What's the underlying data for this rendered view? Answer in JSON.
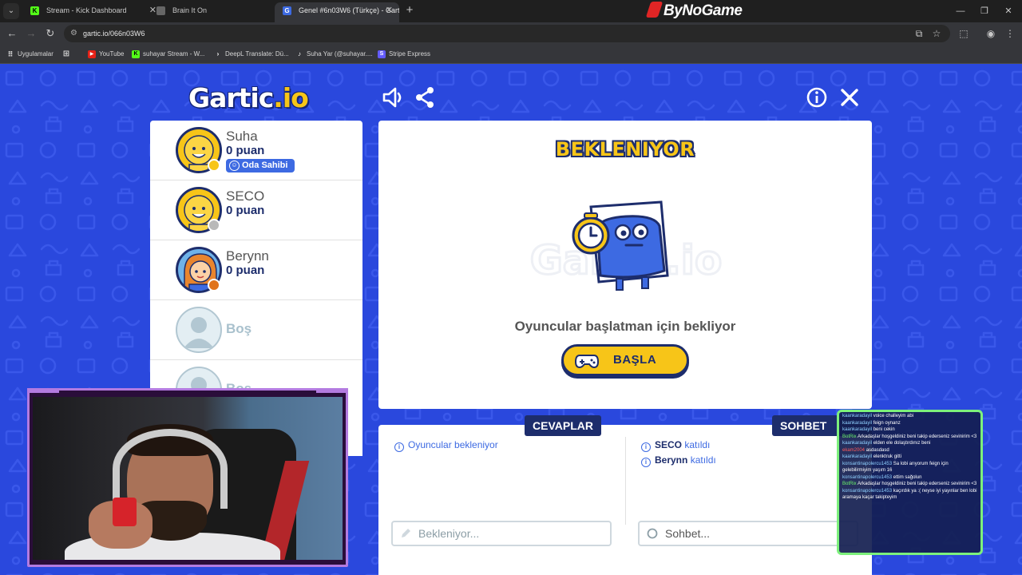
{
  "browser": {
    "tabs": [
      {
        "title": "Stream - Kick Dashboard",
        "favicon": "kick-icon",
        "color": "#53fc18"
      },
      {
        "title": "Brain It On",
        "favicon": "page-icon",
        "color": "#777777"
      },
      {
        "title": "Genel #6n03W6 (Türkçe) - Gart",
        "favicon": "gartic-icon",
        "color": "#3d6ae2"
      }
    ],
    "brand": "ByNoGame",
    "url": "gartic.io/066n03W6",
    "bookmarks": [
      {
        "label": "Uygulamalar"
      },
      {
        "label": "YouTube"
      },
      {
        "label": "suhayar Stream - W..."
      },
      {
        "label": "DeepL Translate: Dü..."
      },
      {
        "label": "Suha Yar (@suhayar...."
      },
      {
        "label": "Stripe Express"
      }
    ]
  },
  "game": {
    "logo_main": "Gartic",
    "logo_suffix": ".io",
    "players": [
      {
        "name": "Suha",
        "score": "0 puan",
        "badge": "Oda Sahibi",
        "status_color": "#f7c518",
        "avatar": "smiley-avatar"
      },
      {
        "name": "SECO",
        "score": "0 puan",
        "status_color": "#b9b9b9",
        "avatar": "smiley-avatar"
      },
      {
        "name": "Berynn",
        "score": "0 puan",
        "status_color": "#e0731c",
        "avatar": "girl-avatar"
      },
      {
        "name": "Boş",
        "empty": true
      },
      {
        "name": "Boş",
        "empty": true
      }
    ],
    "status_title": "BEKLENIYOR",
    "waiting_text": "Oyuncular başlatman için bekliyor",
    "start_button": "BAŞLA",
    "answers_label": "CEVAPLAR",
    "chat_label": "SOHBET",
    "answers_messages": [
      "Oyuncular bekleniyor"
    ],
    "chat_messages": [
      {
        "name": "SECO",
        "text": "katıldı"
      },
      {
        "name": "Berynn",
        "text": "katıldı"
      }
    ],
    "answer_placeholder": "Bekleniyor...",
    "chat_placeholder": "Sohbet..."
  },
  "stream_chat": [
    {
      "user": "kaankaradayil",
      "text": "voice challeyim abi"
    },
    {
      "user": "kaankaradayil",
      "text": "feign oynanz"
    },
    {
      "user": "kaankaradayil",
      "text": "beni cekin"
    },
    {
      "user": "BotRix",
      "text": "Arkadaşlar hoşgeldiniz beni takip ederseniz sevinirim <3"
    },
    {
      "user": "kaankaradayil",
      "text": "elden ele dolaştırdınız beni"
    },
    {
      "user": "ekam2004",
      "text": "asdasdasd"
    },
    {
      "user": "kaankaradayil",
      "text": "elenktruk gitti"
    },
    {
      "user": "konsantinapolercu1453",
      "text": "Sa lobi arıyorum feign için gelebilirmiyim yaşım 16"
    },
    {
      "user": "konsantinapolercu1453",
      "text": "ettim sağolun"
    },
    {
      "user": "BotRix",
      "text": "Arkadaşlar hoşgeldiniz beni takip ederseniz sevinirim <3"
    },
    {
      "user": "konsantinapolercu1453",
      "text": "kaçırdık ya :( neyse iyi yayınlar ben lobi aramaya kaçar takipteyim"
    }
  ],
  "colors": {
    "page_bg": "#2a48dd",
    "accent_yellow": "#f7c518",
    "navy": "#1d2d6c",
    "link_blue": "#3d6ae2",
    "stream_chat_border": "#7cf07c"
  }
}
